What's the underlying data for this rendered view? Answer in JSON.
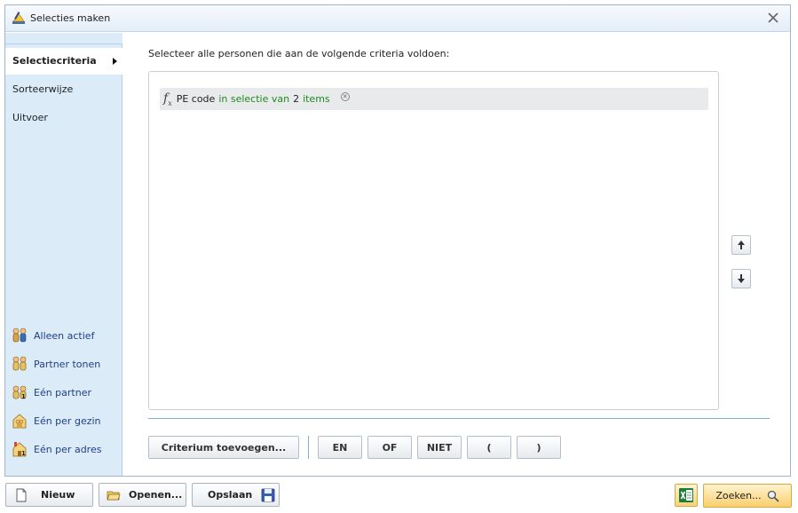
{
  "window": {
    "title": "Selecties maken",
    "close_icon": "close-x-icon"
  },
  "sidebar": {
    "nav": [
      {
        "label": "Selectiecriteria",
        "selected": true
      },
      {
        "label": "Sorteerwijze",
        "selected": false
      },
      {
        "label": "Uitvoer",
        "selected": false
      }
    ],
    "options": [
      {
        "label": "Alleen actief",
        "icon": "active-persons-icon"
      },
      {
        "label": "Partner tonen",
        "icon": "partner-persons-icon"
      },
      {
        "label": "Eén partner",
        "icon": "one-partner-icon"
      },
      {
        "label": "Eén per gezin",
        "icon": "family-house-icon"
      },
      {
        "label": "Eén per adres",
        "icon": "address-house-icon"
      }
    ]
  },
  "main": {
    "intro": "Selecteer alle personen die aan de volgende criteria voldoen:",
    "criteria": [
      {
        "field": "PE code",
        "op": "in selectie van",
        "count": "2",
        "unit": "items"
      }
    ]
  },
  "toolbar": {
    "add": "Criterium toevoegen...",
    "and": "EN",
    "or": "OF",
    "not": "NIET",
    "open_paren": "(",
    "close_paren": ")"
  },
  "footer": {
    "new": "Nieuw",
    "open": "Openen...",
    "save": "Opslaan",
    "search": "Zoeken..."
  },
  "colors": {
    "sidebar_bg": "#dcebf8",
    "green_text": "#1e8b1e",
    "option_text": "#1f3f86",
    "search_btn": "#f9cf6f"
  }
}
